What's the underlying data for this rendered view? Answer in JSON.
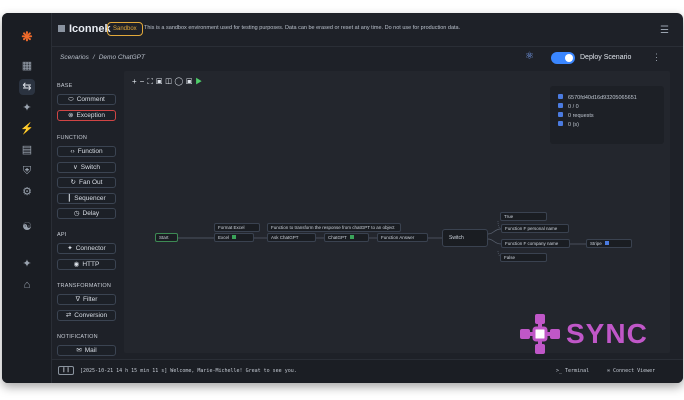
{
  "app": {
    "brand": "Iconnek",
    "env_badge": "Sandbox",
    "notice": "This is a sandbox environment used for testing purposes. Data can be erased or reset at any time. Do not use for production data."
  },
  "breadcrumb": {
    "root": "Scenarios",
    "separator": "/",
    "current": "Demo ChatGPT"
  },
  "deploy": {
    "label": "Deploy Scenario",
    "enabled": true
  },
  "palette": {
    "sections": [
      {
        "title": "BASE",
        "items": [
          {
            "label": "Comment",
            "icon": "comment-icon",
            "glyph": "⬭"
          },
          {
            "label": "Exception",
            "icon": "exception-icon",
            "glyph": "⊗",
            "accent": "#d04545"
          }
        ]
      },
      {
        "title": "FUNCTION",
        "items": [
          {
            "label": "Function",
            "icon": "code-icon",
            "glyph": "‹›"
          },
          {
            "label": "Switch",
            "icon": "switch-icon",
            "glyph": "∨"
          },
          {
            "label": "Fan Out",
            "icon": "fan-out-icon",
            "glyph": "↻"
          },
          {
            "label": "Sequencer",
            "icon": "sequencer-icon",
            "glyph": "┃"
          },
          {
            "label": "Delay",
            "icon": "clock-icon",
            "glyph": "◷"
          }
        ]
      },
      {
        "title": "API",
        "items": [
          {
            "label": "Connector",
            "icon": "connector-icon",
            "glyph": "✦"
          },
          {
            "label": "HTTP",
            "icon": "globe-icon",
            "glyph": "◉"
          }
        ]
      },
      {
        "title": "TRANSFORMATION",
        "items": [
          {
            "label": "Filter",
            "icon": "filter-icon",
            "glyph": "∇"
          },
          {
            "label": "Conversion",
            "icon": "conversion-icon",
            "glyph": "⇄"
          }
        ]
      },
      {
        "title": "NOTIFICATION",
        "items": [
          {
            "label": "Mail",
            "icon": "mail-icon",
            "glyph": "✉"
          }
        ]
      }
    ]
  },
  "canvas": {
    "toolbar": [
      "zoom-in-icon",
      "zoom-out-icon",
      "fit-icon",
      "lock-icon",
      "image-icon",
      "history-icon",
      "save-icon",
      "play-icon"
    ],
    "info": [
      {
        "icon": "id-icon",
        "text": "6570fd40d16d93205065651"
      },
      {
        "icon": "balance-icon",
        "text": "0 / 0"
      },
      {
        "icon": "requests-icon",
        "text": "0 requests"
      },
      {
        "icon": "time-icon",
        "text": "0 (s)"
      }
    ],
    "nodes": {
      "start": "Start",
      "excel": "Excel",
      "ask": "Ask ChatGPT",
      "chatgpt": "ChatGPT",
      "fn_answer": "Function Answer",
      "switch": "Switch",
      "true": "True",
      "fp_name": "Function F personal name",
      "fc_name": "Function F company name",
      "stripe": "Stripe",
      "false": "False",
      "note1": "Format Excel",
      "note2": "Function to transform the response from chatGPT to an object"
    }
  },
  "console": {
    "toggle_label": "❙❙",
    "log": "[2025-10-21 14 h 15 min 11 s] Welcome, Marie-Michelle! Great to see you.",
    "terminal": "Terminal",
    "viewer": "Connect Viewer"
  },
  "watermark": {
    "text": "SYNC",
    "color": "#c057c8"
  }
}
